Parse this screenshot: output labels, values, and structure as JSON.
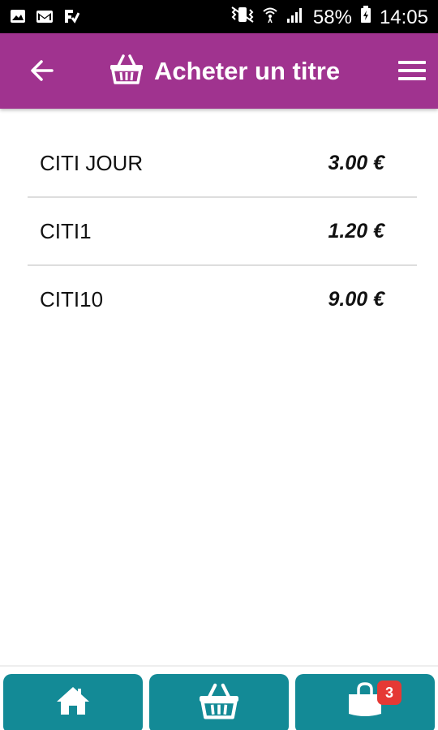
{
  "status_bar": {
    "battery": "58%",
    "time": "14:05",
    "icons": [
      "image-notification-icon",
      "gmail-icon",
      "app-notification-icon",
      "vibrate-icon",
      "wifi-icon",
      "signal-icon",
      "battery-icon"
    ]
  },
  "app_bar": {
    "title": "Acheter un titre",
    "icons": [
      "back-arrow-icon",
      "basket-icon",
      "hamburger-menu-icon"
    ],
    "color": "#a0338f"
  },
  "tickets": [
    {
      "name": "CITI JOUR",
      "price": "3.00 €"
    },
    {
      "name": "CITI1",
      "price": "1.20 €"
    },
    {
      "name": "CITI10",
      "price": "9.00 €"
    }
  ],
  "bottom_nav": {
    "color": "#138a96",
    "items": [
      {
        "icon": "home-icon"
      },
      {
        "icon": "basket-icon"
      },
      {
        "icon": "shopping-bag-icon",
        "badge": "3"
      }
    ]
  }
}
